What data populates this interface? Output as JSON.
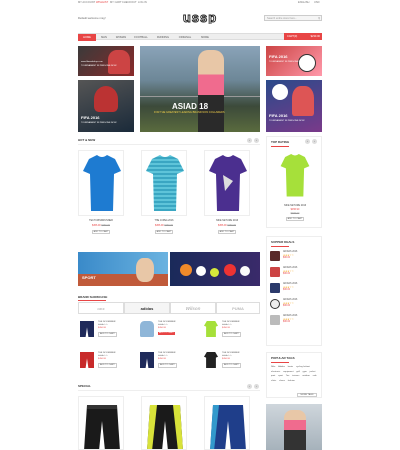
{
  "topbar": {
    "links": [
      "MY ACCOUNT",
      "WISHLIST",
      "MY CART",
      "CHECKOUT",
      "LOG IN"
    ],
    "right": [
      "ENGLISH",
      "USD"
    ]
  },
  "header": {
    "logo": "ussp",
    "welcome": "Default welcome msg!",
    "search_placeholder": "Search entire store here..."
  },
  "nav": {
    "items": [
      "HOME",
      "MAN",
      "WOMAN",
      "FOOTBALL",
      "RUNNING",
      "ORIGINAL",
      "MORE"
    ],
    "cart_label": "CART(0)",
    "cart_total": "$230.00"
  },
  "banners": {
    "left_top": {
      "line1": "www.fifaworldcup.com",
      "line2": "TOURNAMENT IN PERSONE NOW"
    },
    "left_bottom": {
      "line1": "FIFA 2016",
      "line2": "TOURNAMENT IN PERSONE NOW"
    },
    "center": {
      "title": "ASIAD 18",
      "sub": "FOR THE GREATEST LEADING BRAND NON COLLAREDS"
    },
    "right_top": {
      "line1": "FIFA 2016",
      "line2": "TOURNAMENT IN PERSONE NOW"
    },
    "right_bottom": {
      "line1": "FIFA 2016",
      "line2": "TOURNAMENT IN PERSONE NOW"
    }
  },
  "hot_new": {
    "title": "HOT & NEW",
    "products": [
      {
        "name": "TECH WINDRUNNER",
        "price": "$456.90",
        "old": "$466.00",
        "add": "ADD TO CART"
      },
      {
        "name": "THE JUPEA 2016",
        "price": "$456.90",
        "old": "$466.00",
        "add": "ADD TO CART"
      },
      {
        "name": "NIKE NETURE 2016",
        "price": "$456.90",
        "old": "$466.00",
        "add": "ADD TO CART"
      }
    ]
  },
  "top_rating": {
    "title": "TOP RATING",
    "product": {
      "name": "NIKE NETURE 2016",
      "price": "$456.90",
      "old": "$466.00",
      "add": "ADD TO CART"
    }
  },
  "supper_deals": {
    "title": "SUPPER DEALS",
    "items": [
      {
        "name": "ADIDAS 2016",
        "price": "$36.00"
      },
      {
        "name": "ADIDAS 2016",
        "price": "$36.00"
      },
      {
        "name": "ADIDAS 2016",
        "price": "$36.00"
      },
      {
        "name": "ADIDAS 2016",
        "price": "$36.00"
      },
      {
        "name": "ADIDAS 2016",
        "price": "$36.00"
      }
    ]
  },
  "sport_banner": {
    "label": "SPORT"
  },
  "brand_showcase": {
    "title": "BRAND SHOWCASE",
    "brands": [
      "NIKE",
      "adidas",
      "Wilson",
      "PUMA"
    ],
    "items": [
      {
        "name": "THE NOVEMBER",
        "price": "$456.90",
        "add": "ADD TO CART"
      },
      {
        "name": "THE NOVEMBER",
        "price": "$456.90",
        "add": "ADD TO CART"
      },
      {
        "name": "THE NOVEMBER",
        "price": "$456.90",
        "add": "ADD TO CART"
      },
      {
        "name": "THE NOVEMBER",
        "price": "$456.90",
        "add": "ADD TO CART"
      },
      {
        "name": "THE NOVEMBER",
        "price": "$456.90",
        "add": "ADD TO CART"
      },
      {
        "name": "THE NOVEMBER",
        "price": "$456.90",
        "add": "ADD TO CART"
      }
    ]
  },
  "popular_tags": {
    "title": "POPULAR TAGS",
    "tags": [
      "Nike",
      "Adidas",
      "boots",
      "cycling helmet",
      "electronic",
      "equipment",
      "golf",
      "gym",
      "jacket",
      "pant",
      "sport",
      "Tee",
      "trainers",
      "outdoor",
      "sale",
      "shirts",
      "shoes",
      "fashion"
    ],
    "more": "MORE TAGS"
  },
  "special": {
    "title": "SPECIAL"
  },
  "colors": {
    "accent": "#e84545"
  }
}
